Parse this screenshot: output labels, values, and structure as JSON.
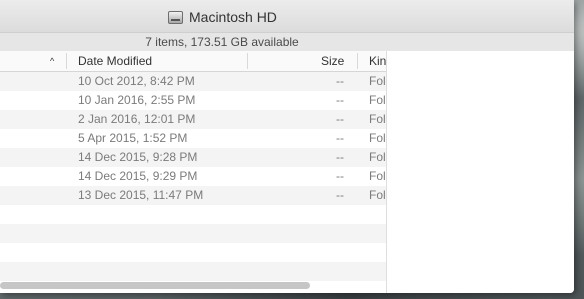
{
  "window": {
    "title": "Macintosh HD",
    "title_icon": "hard-drive-icon"
  },
  "status": {
    "text": "7 items, 173.51 GB available"
  },
  "columns": {
    "sort_icon": "sort-ascending-icon",
    "sort_glyph": "^",
    "date_modified": "Date Modified",
    "size": "Size",
    "kind": "Kin"
  },
  "rows": [
    {
      "date": "10 Oct 2012, 8:42 PM",
      "size": "--",
      "kind": "Fol"
    },
    {
      "date": "10 Jan 2016, 2:55 PM",
      "size": "--",
      "kind": "Fol"
    },
    {
      "date": "2 Jan 2016, 12:01 PM",
      "size": "--",
      "kind": "Fol"
    },
    {
      "date": "5 Apr 2015, 1:52 PM",
      "size": "--",
      "kind": "Fol"
    },
    {
      "date": "14 Dec 2015, 9:28 PM",
      "size": "--",
      "kind": "Fol"
    },
    {
      "date": "14 Dec 2015, 9:29 PM",
      "size": "--",
      "kind": "Fol"
    },
    {
      "date": "13 Dec 2015, 11:47 PM",
      "size": "--",
      "kind": "Fol"
    }
  ]
}
